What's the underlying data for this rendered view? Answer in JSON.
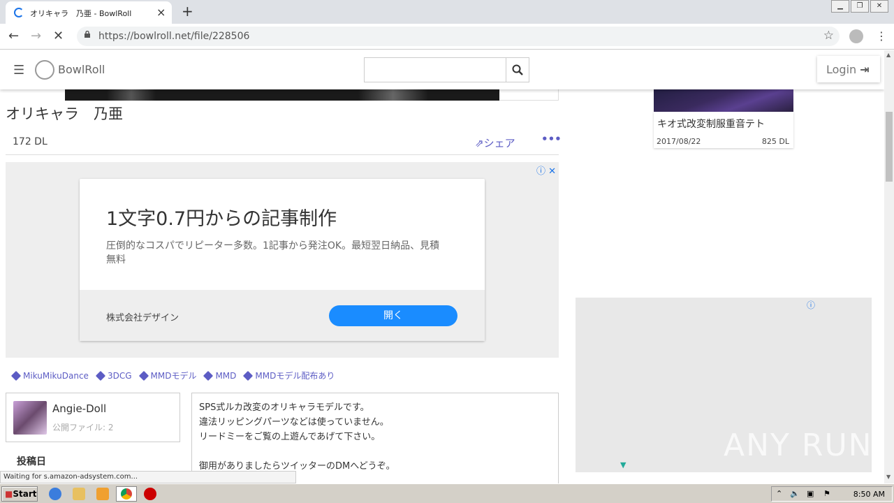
{
  "browser": {
    "tab_title": "オリキャラ　乃亜 - BowlRoll",
    "tab_close": "×",
    "new_tab": "+",
    "url": "https://bowlroll.net/file/228506"
  },
  "site": {
    "logo_text": "BowlRoll",
    "login_label": "Login"
  },
  "file": {
    "title": "オリキャラ　乃亜",
    "downloads": "172 DL",
    "share_label": "シェア",
    "more_label": "•••"
  },
  "ad": {
    "headline": "1文字0.7円からの記事制作",
    "description": "圧倒的なコスパでリピーター多数。1記事から発注OK。最短翌日納品、見積無料",
    "advertiser": "株式会社デザイン",
    "cta": "開く"
  },
  "tags": [
    "MikuMikuDance",
    "3DCG",
    "MMDモデル",
    "MMD",
    "MMDモデル配布あり"
  ],
  "author": {
    "name": "Angie-Doll",
    "files": "公開ファイル: 2"
  },
  "posted_label": "投稿日",
  "description_lines": [
    "SPS式ルカ改変のオリキャラモデルです。",
    "違法リッピングパーツなどは使っていません。",
    "リードミーをご覧の上遊んであげて下さい。",
    "",
    "御用がありましたらツイッターのDMへどうぞ。"
  ],
  "sidebar": {
    "title": "キオ式改変制服重音テト",
    "date": "2017/08/22",
    "downloads": "825 DL"
  },
  "watermark": "ANY RUN",
  "status": "Waiting for s.amazon-adsystem.com...",
  "taskbar": {
    "start": "Start",
    "clock": "8:50 AM"
  },
  "colors": {
    "link": "#5c5cc4",
    "ad_button": "#1a8cff"
  }
}
